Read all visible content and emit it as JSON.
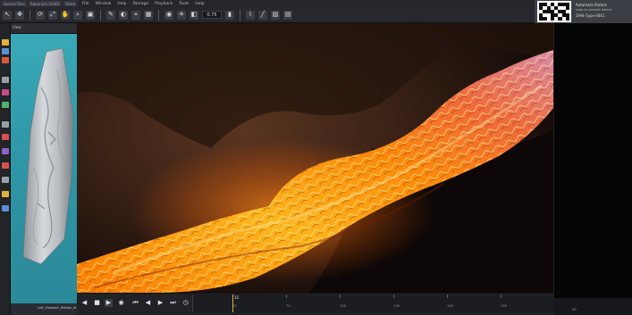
{
  "window": {
    "tabs": [
      "Source Files",
      "Aquarium 01d01",
      "Vesta"
    ],
    "menus": [
      "File",
      "Window",
      "Help",
      "Storage",
      "Playback",
      "Tools",
      "Help"
    ],
    "zoom_value": "0.75"
  },
  "overlay": {
    "line1": "Automata Station",
    "line2": "scan to connect device",
    "line3": "1/Hd-7ppv-0441"
  },
  "left_panel": {
    "tab_label": "View",
    "status_text": "Left_Viewport_Hidden_id"
  },
  "timeline": {
    "current_frame": "15",
    "ticks": [
      "45",
      "75",
      "105",
      "135",
      "165",
      "195"
    ],
    "right_readout": "-40"
  },
  "icons": {
    "toolbar": [
      "select-icon",
      "move-icon",
      "rotate-icon",
      "scale-icon",
      "pan-icon",
      "zoom-icon",
      "frame-icon",
      "brush-icon",
      "sculpt-icon",
      "snap-icon",
      "grid-icon",
      "camera-icon",
      "light-icon",
      "mask-icon",
      "paint-icon",
      "image-icon",
      "trash-icon"
    ],
    "timeline": [
      "prev-icon",
      "stop-icon",
      "play-icon",
      "loop-icon",
      "first-frame-icon",
      "step-back-icon",
      "step-forward-icon",
      "last-frame-icon",
      "clock-icon"
    ]
  },
  "colors": {
    "lava_hot": "#ffb21f",
    "lava_core": "#ff6a00",
    "rock_dark": "#1a100b",
    "left_viewport": "#2f97a7",
    "playhead": "#e8a63a"
  }
}
